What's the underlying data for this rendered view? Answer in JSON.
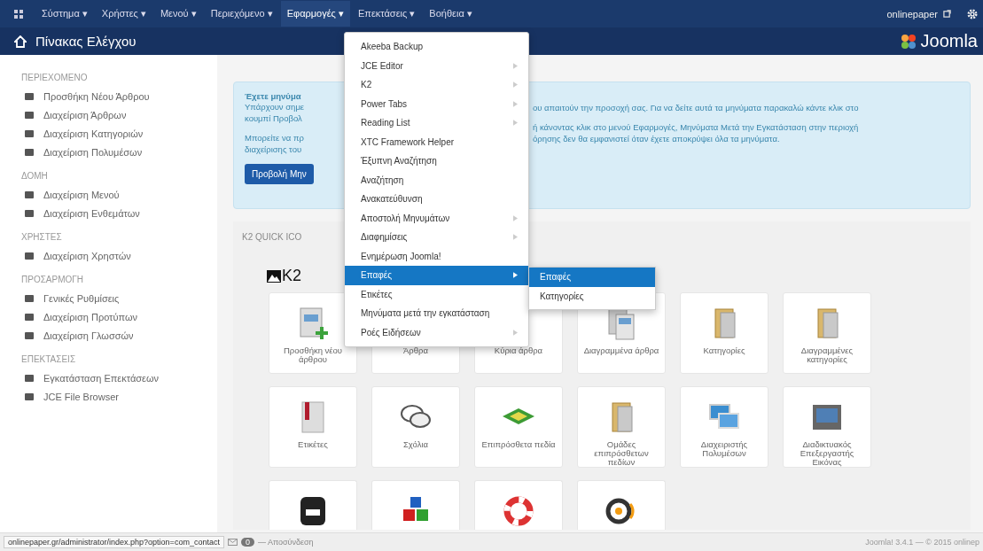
{
  "top_menu": [
    {
      "label": "Σύστημα",
      "caret": "▾",
      "open": false
    },
    {
      "label": "Χρήστες",
      "caret": "▾",
      "open": false
    },
    {
      "label": "Μενού",
      "caret": "▾",
      "open": false
    },
    {
      "label": "Περιεχόμενο",
      "caret": "▾",
      "open": false
    },
    {
      "label": "Εφαρμογές",
      "caret": "▾",
      "open": true
    },
    {
      "label": "Επεκτάσεις",
      "caret": "▾",
      "open": false
    },
    {
      "label": "Βοήθεια",
      "caret": "▾",
      "open": false
    }
  ],
  "user": {
    "name": "onlinepaper"
  },
  "header": {
    "title": "Πίνακας Ελέγχου",
    "logo": "Joomla"
  },
  "sidebar": [
    {
      "heading": "ΠΕΡΙΕΧΟΜΕΝΟ",
      "items": [
        "Προσθήκη Νέου Άρθρου",
        "Διαχείριση Άρθρων",
        "Διαχείριση Κατηγοριών",
        "Διαχείριση Πολυμέσων"
      ]
    },
    {
      "heading": "ΔΟΜΗ",
      "items": [
        "Διαχείριση Μενού",
        "Διαχείριση Ενθεμάτων"
      ]
    },
    {
      "heading": "ΧΡΗΣΤΕΣ",
      "items": [
        "Διαχείριση Χρηστών"
      ]
    },
    {
      "heading": "ΠΡΟΣΑΡΜΟΓΗ",
      "items": [
        "Γενικές Ρυθμίσεις",
        "Διαχείριση Προτύπων",
        "Διαχείριση Γλωσσών"
      ]
    },
    {
      "heading": "ΕΠΕΚΤΑΣΕΙΣ",
      "items": [
        "Εγκατάσταση Επεκτάσεων",
        "JCE File Browser"
      ]
    }
  ],
  "message": {
    "title": "Έχετε μηνύμα",
    "left_lines": [
      "Υπάρχουν σημε",
      "κουμπί Προβολ",
      "Μπορείτε να πρ",
      "διαχείρισης του"
    ],
    "right_lines": [
      "ου απαιτούν την προσοχή σας. Για να δείτε αυτά τα μηνύματα παρακαλώ κάντε κλικ στο",
      "ή κάνοντας κλικ στο μενού Εφαρμογές, Μηνύματα Μετά την Εγκατάσταση στην περιοχή",
      "όρησης δεν θα εμφανιστεί όταν έχετε αποκρύψει όλα τα μηνύματα."
    ],
    "button": "Προβολή Μην"
  },
  "k2_panel": {
    "heading": "K2 QUICK ICO",
    "logo": "K2",
    "tiles": [
      {
        "kind": "full",
        "label": "Προσθήκη νέου άρθρου"
      },
      {
        "kind": "full",
        "label": "Άρθρα"
      },
      {
        "kind": "full",
        "label": "Κύρια άρθρα"
      },
      {
        "kind": "full",
        "label": "Διαγραμμένα άρθρα"
      },
      {
        "kind": "full",
        "label": "Κατηγορίες"
      },
      {
        "kind": "full",
        "label": "Διαγραμμένες κατηγορίες"
      },
      {
        "kind": "full",
        "label": "Ετικέτες"
      },
      {
        "kind": "full",
        "label": "Σχόλια"
      },
      {
        "kind": "full",
        "label": "Επιπρόσθετα πεδία"
      },
      {
        "kind": "full",
        "label": "Ομάδες επιπρόσθετων πεδίων"
      },
      {
        "kind": "full",
        "label": "Διαχειριστής Πολυμέσων"
      },
      {
        "kind": "full",
        "label": "Διαδικτυακός Επεξεργαστής Εικόνας"
      },
      {
        "kind": "cut"
      },
      {
        "kind": "cut"
      },
      {
        "kind": "cut"
      },
      {
        "kind": "cut"
      }
    ]
  },
  "dropdown": [
    {
      "label": "Akeeba Backup",
      "submenu": false,
      "selected": false
    },
    {
      "label": "JCE Editor",
      "submenu": true,
      "selected": false
    },
    {
      "label": "K2",
      "submenu": true,
      "selected": false
    },
    {
      "label": "Power Tabs",
      "submenu": true,
      "selected": false
    },
    {
      "label": "Reading List",
      "submenu": true,
      "selected": false
    },
    {
      "label": "XTC Framework Helper",
      "submenu": false,
      "selected": false
    },
    {
      "label": "Έξυπνη Αναζήτηση",
      "submenu": false,
      "selected": false
    },
    {
      "label": "Αναζήτηση",
      "submenu": false,
      "selected": false
    },
    {
      "label": "Ανακατεύθυνση",
      "submenu": false,
      "selected": false
    },
    {
      "label": "Αποστολή Μηνυμάτων",
      "submenu": true,
      "selected": false
    },
    {
      "label": "Διαφημίσεις",
      "submenu": true,
      "selected": false
    },
    {
      "label": "Ενημέρωση Joomla!",
      "submenu": false,
      "selected": false
    },
    {
      "label": "Επαφές",
      "submenu": true,
      "selected": true
    },
    {
      "label": "Ετικέτες",
      "submenu": false,
      "selected": false
    },
    {
      "label": "Μηνύματα μετά την εγκατάσταση",
      "submenu": false,
      "selected": false
    },
    {
      "label": "Ροές Ειδήσεων",
      "submenu": true,
      "selected": false
    }
  ],
  "submenu": [
    {
      "label": "Επαφές",
      "selected": true
    },
    {
      "label": "Κατηγορίες",
      "selected": false
    }
  ],
  "status_bar": {
    "url": "onlinepaper.gr/administrator/index.php?option=com_contact",
    "badge": "0",
    "logout": "— Αποσύνδεση",
    "version": "Joomla! 3.4.1 — © 2015 onlinep"
  }
}
